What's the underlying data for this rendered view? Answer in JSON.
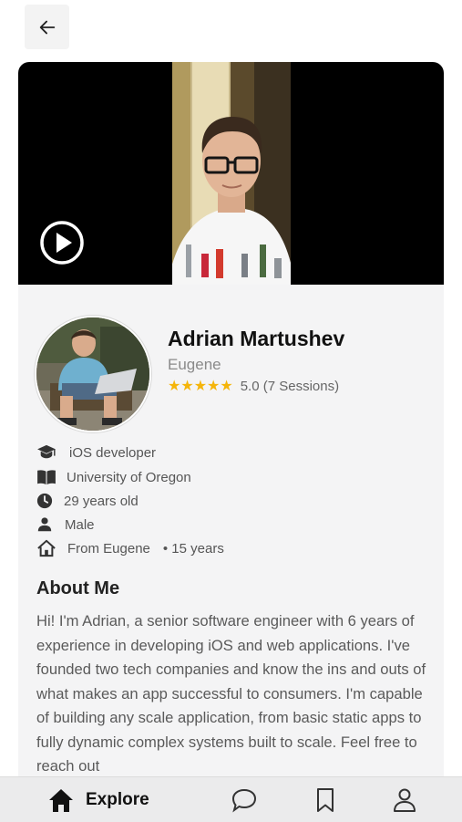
{
  "header": {
    "back_icon": "arrow-left-icon"
  },
  "video": {
    "play_icon": "play-icon"
  },
  "profile": {
    "name": "Adrian Martushev",
    "subname": "Eugene",
    "stars": "★★★★★",
    "rating_text": "5.0 (7 Sessions)"
  },
  "facts": [
    {
      "icon": "graduation-cap-icon",
      "text": "iOS developer"
    },
    {
      "icon": "book-icon",
      "text": "University of Oregon"
    },
    {
      "icon": "clock-icon",
      "text": "29 years old"
    },
    {
      "icon": "person-icon",
      "text": "Male"
    },
    {
      "icon": "home-icon",
      "text": "From Eugene",
      "extra": "• 15 years"
    }
  ],
  "about": {
    "title": "About Me",
    "text": "Hi! I'm Adrian, a senior software engineer with 6 years of experience in developing iOS and web applications. I've founded two tech companies and know the ins and outs of what makes an app successful to consumers. I'm capable of building any scale application, from basic static apps to fully dynamic complex systems built to scale. Feel free to reach out"
  },
  "tabbar": {
    "explore_label": "Explore",
    "items": [
      "home-icon",
      "chat-icon",
      "bookmark-icon",
      "profile-icon"
    ]
  },
  "colors": {
    "star": "#f5b50a",
    "card_bg": "#f4f4f5",
    "tabbar_bg": "#ebebec"
  }
}
